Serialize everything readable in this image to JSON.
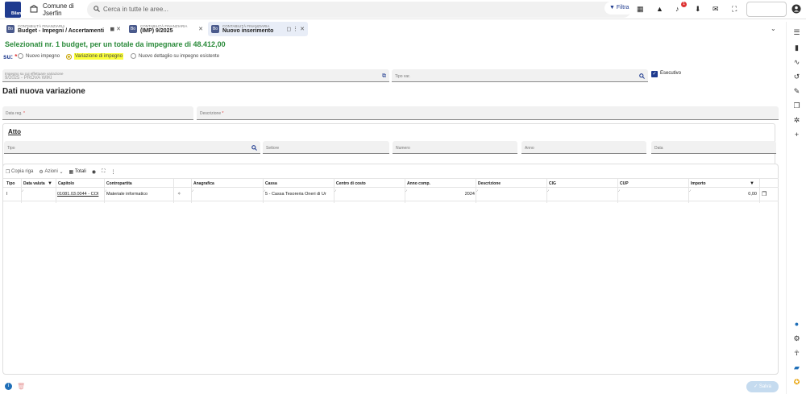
{
  "topbar": {
    "org_line1": "Comune di",
    "org_line2": "Jserfin",
    "search_placeholder": "Cerca in tutte le aree...",
    "filter_label": "Filtra",
    "notification_count": "1"
  },
  "tabs": [
    {
      "category": "CONTABILITÀ FINANZIARIA",
      "title": "Budget - Impegni / Accertamenti",
      "icon": "Bo"
    },
    {
      "category": "CONTABILITÀ FINANZIARIA",
      "title": "(IMP) 9/2025",
      "icon": "Bo"
    },
    {
      "category": "CONTABILITÀ FINANZIARIA",
      "title": "Nuovo inserimento",
      "icon": "Bo"
    }
  ],
  "headline": "Selezionati nr. 1 budget, per un totale da impegnare di 48.412,00",
  "su": {
    "label": "su:",
    "options": [
      "Nuovo impegno",
      "Variazione di impegno",
      "Nuovo dettaglio su impegno esistente"
    ],
    "selected": "Variazione di impegno"
  },
  "impegno_field": {
    "label": "Impegno su cui effettuare variazione",
    "value": "9/2025 - PROVA WIKI"
  },
  "tipo_var": {
    "label": "Tipo var."
  },
  "esecutivo": {
    "label": "Esecutivo",
    "checked": true
  },
  "section_title": "Dati nuova variazione",
  "data_reg": {
    "label": "Data reg."
  },
  "descrizione": {
    "label": "Descrizione"
  },
  "atto": {
    "title": "Atto",
    "fields": [
      "Tipo",
      "Settore",
      "Numero",
      "Anno",
      "Data"
    ]
  },
  "grid": {
    "toolbar": {
      "copia_riga": "Copia riga",
      "azioni": "Azioni",
      "totali": "Totali"
    },
    "columns": [
      "Tipo",
      "Data valuta",
      "Capitolo",
      "Contropartita",
      "Anagrafica",
      "Cassa",
      "Centro di costo",
      "Anno comp.",
      "Descrizione",
      "CIG",
      "CUP",
      "Importo"
    ],
    "rows": [
      {
        "tipo": "I",
        "data_valuta": "",
        "capitolo": "01081.03.0044 - COI",
        "contropartita": "Materiale informatico",
        "anagrafica": "",
        "cassa": "5 - Cassa Tesoreria Oneri di Ur",
        "centro_di_costo": "",
        "anno_comp": "2024",
        "descrizione": "",
        "cig": "",
        "cup": "",
        "importo": "0,00"
      }
    ]
  },
  "footer": {
    "salva_label": "Salva"
  },
  "colors": {
    "accent": "#1f3b8f",
    "headline": "#2a8a3a",
    "highlight": "#fbff3a"
  }
}
